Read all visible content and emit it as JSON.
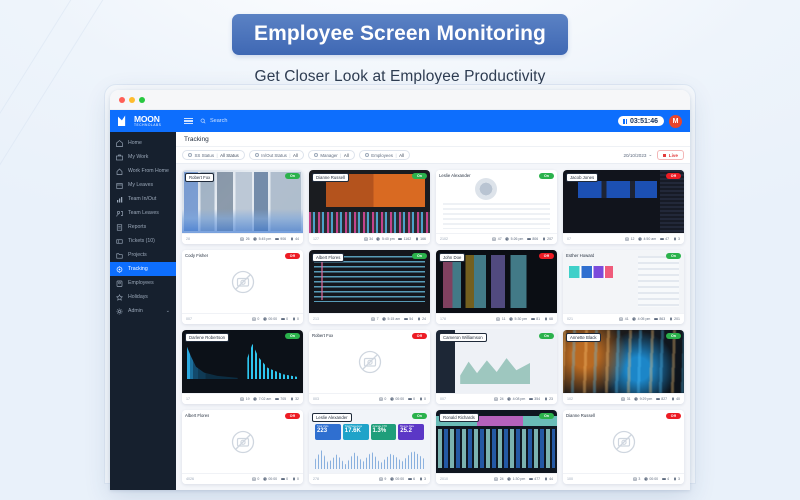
{
  "header": {
    "title": "Employee Screen Monitoring",
    "subtitle": "Get Closer Look at Employee Productivity"
  },
  "colors": {
    "accent": "#0d6efd",
    "title_pill": "#4269b6",
    "sidebar_bg": "#16202e",
    "online": "#2bb24c",
    "offline": "#ed1c24",
    "live": "#e23b3b"
  },
  "topbar": {
    "logo_name": "MOON",
    "logo_sub": "TECHNOLABS",
    "menu_icon": "hamburger-icon",
    "search_icon": "search-icon",
    "search_placeholder": "Search",
    "timer": "03:51:46",
    "timer_icon": "pause-icon",
    "avatar_initial": "M"
  },
  "sidebar": {
    "items": [
      {
        "label": "Home",
        "icon": "home-icon",
        "active": false
      },
      {
        "label": "My Work",
        "icon": "briefcase-icon",
        "active": false
      },
      {
        "label": "Work From Home",
        "icon": "house-icon",
        "active": false
      },
      {
        "label": "My Leaves",
        "icon": "calendar-icon",
        "active": false
      },
      {
        "label": "Team In/Out",
        "icon": "chart-icon",
        "active": false
      },
      {
        "label": "Team Leaves",
        "icon": "people-icon",
        "active": false
      },
      {
        "label": "Reports",
        "icon": "document-icon",
        "active": false
      },
      {
        "label": "Tickets (10)",
        "icon": "ticket-icon",
        "active": false
      },
      {
        "label": "Projects",
        "icon": "folder-icon",
        "active": false
      },
      {
        "label": "Tracking",
        "icon": "target-icon",
        "active": true
      },
      {
        "label": "Employees",
        "icon": "id-badge-icon",
        "active": false
      },
      {
        "label": "Holidays",
        "icon": "star-icon",
        "active": false
      },
      {
        "label": "Admin",
        "icon": "gear-icon",
        "active": false,
        "caret": "⌄"
      }
    ]
  },
  "main": {
    "page_title": "Tracking",
    "filters": [
      {
        "label": "SS Status",
        "value": "All Status"
      },
      {
        "label": "In/Out Status",
        "value": "All"
      },
      {
        "label": "Manager",
        "value": "All"
      },
      {
        "label": "Employees",
        "value": "All"
      }
    ],
    "date": "20/10/2023",
    "date_caret": "⌄",
    "live_label": "Live"
  },
  "cards": [
    {
      "name": "Robert Fox",
      "status": "On",
      "art": "art-moodboard",
      "dark": true,
      "time_left": "28",
      "stats": [
        "26",
        "5:45 pm",
        "906",
        "44"
      ]
    },
    {
      "name": "Dianne Russell",
      "status": "On",
      "art": "art-video",
      "dark": true,
      "time_left": "127",
      "stats": [
        "34",
        "5:40 pm",
        "1162",
        "166"
      ]
    },
    {
      "name": "Leslie Alexander",
      "status": "On",
      "art": "art-profile",
      "dark": false,
      "time_left": "2102",
      "stats": [
        "47",
        "5:26 pm",
        "806",
        "207"
      ]
    },
    {
      "name": "Jacob Jones",
      "status": "Off",
      "art": "art-webdark",
      "dark": true,
      "time_left": "07",
      "stats": [
        "12",
        "4:50 am",
        "47",
        "3"
      ]
    },
    {
      "name": "Cody Fisher",
      "status": "Off",
      "art": "noimg",
      "dark": false,
      "time_left": "007",
      "stats": [
        "0",
        "00:00",
        "0",
        "0"
      ]
    },
    {
      "name": "Albert Flores",
      "status": "On",
      "art": "art-codeide",
      "dark": true,
      "time_left": "213",
      "stats": [
        "7",
        "5:15 am",
        "54",
        "24"
      ]
    },
    {
      "name": "John Doe",
      "status": "Off",
      "art": "art-code",
      "dark": true,
      "time_left": "178",
      "stats": [
        "11",
        "5:30 pm",
        "81",
        "68"
      ]
    },
    {
      "name": "Esther Howard",
      "status": "On",
      "art": "art-designsys",
      "dark": false,
      "time_left": "021",
      "stats": [
        "41",
        "4:05 pm",
        "863",
        "201"
      ]
    },
    {
      "name": "Darlene Robertson",
      "status": "On",
      "art": "art-charts",
      "dark": true,
      "time_left": "17",
      "stats": [
        "19",
        "7:02 am",
        "705",
        "32"
      ]
    },
    {
      "name": "Robert Fox",
      "status": "Off",
      "art": "noimg",
      "dark": false,
      "time_left": "003",
      "stats": [
        "0",
        "00:00",
        "0",
        "0"
      ]
    },
    {
      "name": "Cameron Williamson",
      "status": "On",
      "art": "art-dashboard",
      "dark": true,
      "time_left": "007",
      "stats": [
        "24",
        "4:08 pm",
        "354",
        "23"
      ]
    },
    {
      "name": "Annette Black",
      "status": "On",
      "art": "art-bokeh",
      "dark": true,
      "time_left": "102",
      "stats": [
        "31",
        "9:29 pm",
        "827",
        "40"
      ]
    },
    {
      "name": "Albert Flores",
      "status": "Off",
      "art": "noimg",
      "dark": false,
      "time_left": "4026",
      "stats": [
        "0",
        "00:00",
        "0",
        "0"
      ]
    },
    {
      "name": "Leslie Alexander",
      "status": "On",
      "art": "art-kpi",
      "dark": true,
      "time_left": "278",
      "stats": [
        "9",
        "00:00",
        "6",
        "3"
      ]
    },
    {
      "name": "Ronald Richards",
      "status": "On",
      "art": "art-editor",
      "dark": true,
      "time_left": "2010",
      "stats": [
        "24",
        "1:30 pm",
        "477",
        "44"
      ]
    },
    {
      "name": "Dianne Russell",
      "status": "Off",
      "art": "noimg",
      "dark": false,
      "time_left": "100",
      "stats": [
        "3",
        "00:00",
        "4",
        "3"
      ]
    }
  ],
  "kpi_card": {
    "metrics": [
      {
        "label": "Total Visits",
        "value": "223",
        "color": "#2f6fd0"
      },
      {
        "label": "Total Pageviews",
        "value": "17.6K",
        "color": "#1fa3c9"
      },
      {
        "label": "Avarage CTR",
        "value": "1.3%",
        "color": "#1f9e7a"
      },
      {
        "label": "Bounce Rate",
        "value": "25.2",
        "color": "#5b37c6"
      }
    ]
  },
  "stat_icons": [
    "screenshot-icon",
    "clock-icon",
    "keyboard-icon",
    "mouse-icon"
  ],
  "noimage_icon": "no-screenshot-icon"
}
